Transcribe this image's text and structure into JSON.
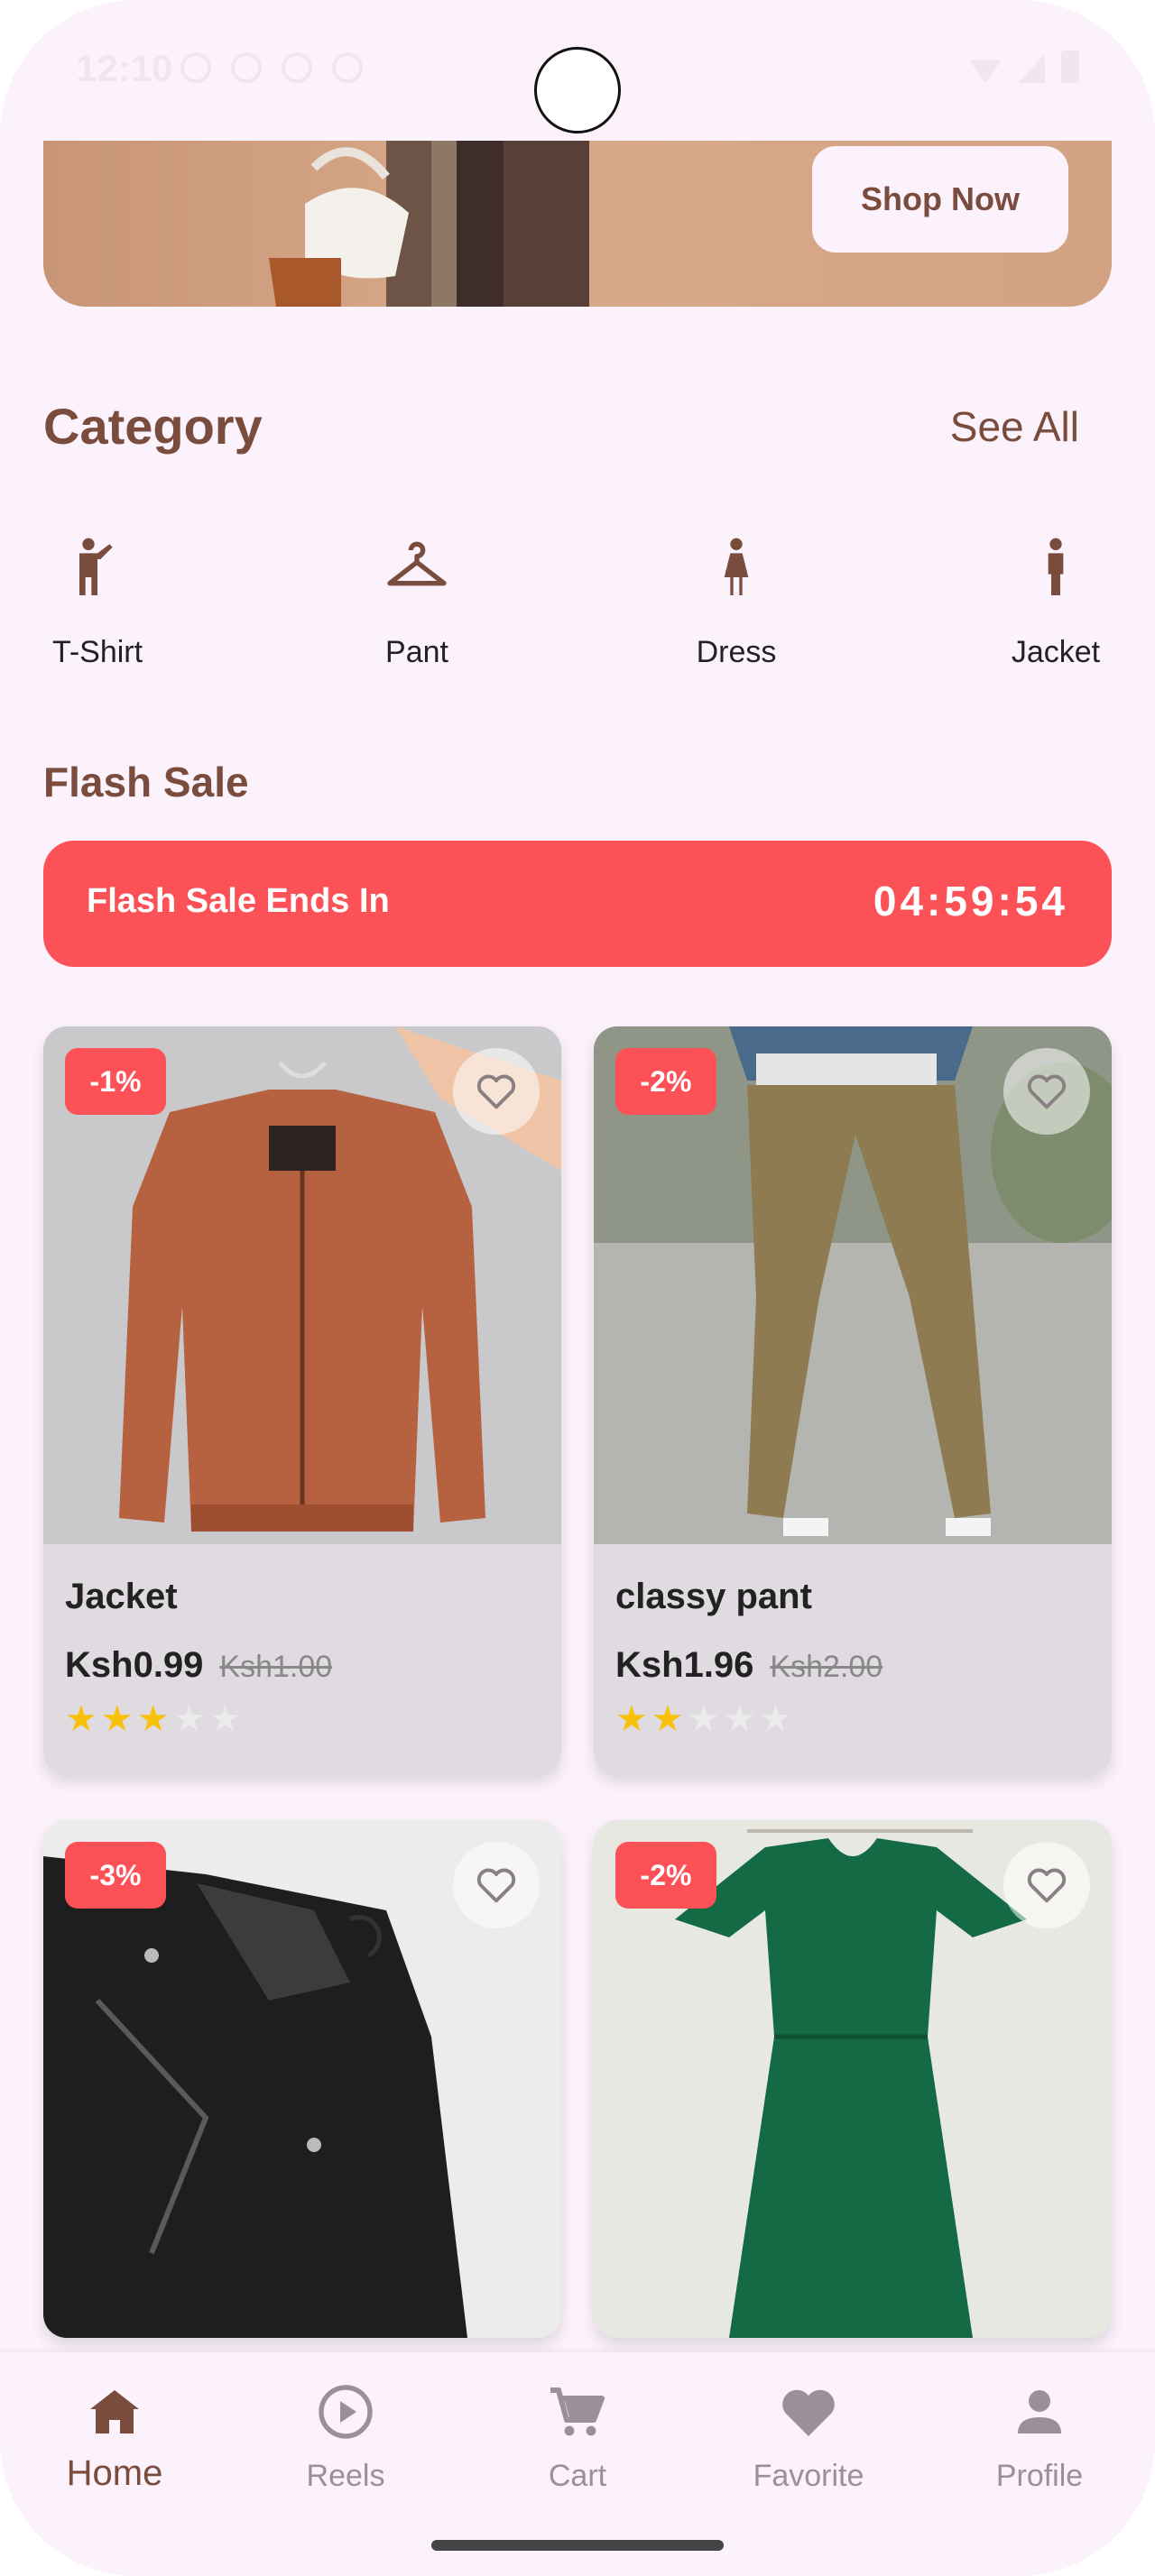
{
  "status_bar": {
    "time": "12:10"
  },
  "banner": {
    "button_label": "Shop Now"
  },
  "category_section": {
    "title": "Category",
    "see_all": "See All",
    "items": [
      {
        "label": "T-Shirt",
        "icon": "person-waving-icon"
      },
      {
        "label": "Pant",
        "icon": "hanger-icon"
      },
      {
        "label": "Dress",
        "icon": "woman-icon"
      },
      {
        "label": "Jacket",
        "icon": "man-icon"
      }
    ]
  },
  "flash_sale": {
    "title": "Flash Sale",
    "ends_label": "Flash Sale Ends In",
    "timer": "04:59:54"
  },
  "products": [
    {
      "name": "Jacket",
      "price": "Ksh0.99",
      "old_price": "Ksh1.00",
      "discount": "-1%",
      "rating": 3,
      "image": "orange-bomber-jacket"
    },
    {
      "name": "classy pant",
      "price": "Ksh1.96",
      "old_price": "Ksh2.00",
      "discount": "-2%",
      "rating": 2,
      "image": "khaki-pants"
    },
    {
      "name": "",
      "price": "",
      "old_price": "",
      "discount": "-3%",
      "rating": 0,
      "image": "black-leather-jacket"
    },
    {
      "name": "",
      "price": "",
      "old_price": "",
      "discount": "-2%",
      "rating": 0,
      "image": "green-dress"
    }
  ],
  "bottom_nav": {
    "items": [
      {
        "label": "Home",
        "icon": "home-icon",
        "active": true
      },
      {
        "label": "Reels",
        "icon": "play-circle-icon",
        "active": false
      },
      {
        "label": "Cart",
        "icon": "cart-icon",
        "active": false
      },
      {
        "label": "Favorite",
        "icon": "heart-icon",
        "active": false
      },
      {
        "label": "Profile",
        "icon": "person-icon",
        "active": false
      }
    ]
  },
  "colors": {
    "brand_brown": "#7a4c3e",
    "sale_red": "#fc5257",
    "background": "#fcf2fb",
    "star": "#f8c10b"
  }
}
